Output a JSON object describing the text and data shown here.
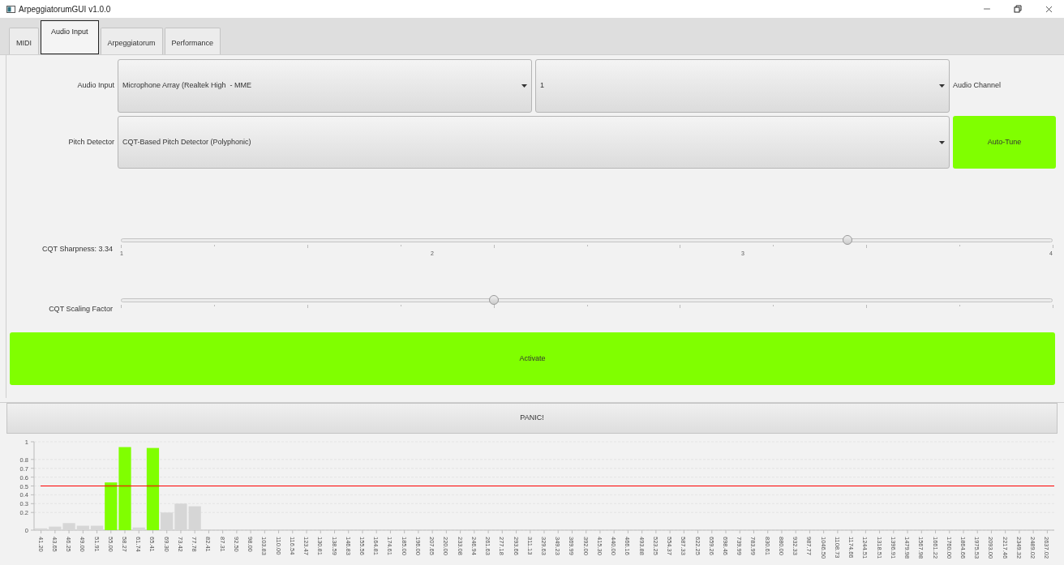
{
  "window": {
    "title": "ArpeggiatorumGUI v1.0.0"
  },
  "tabs": [
    {
      "label": "MIDI",
      "selected": false
    },
    {
      "label": "Audio Input",
      "selected": true
    },
    {
      "label": "Arpeggiatorum",
      "selected": false
    },
    {
      "label": "Performance",
      "selected": false
    }
  ],
  "audio_input": {
    "label": "Audio Input",
    "device": "Microphone Array (Realtek High  - MME",
    "channel": "1",
    "channel_label": "Audio Channel"
  },
  "pitch_detector": {
    "label": "Pitch Detector",
    "value": "CQT-Based Pitch Detector (Polyphonic)",
    "button": "Auto-Tune"
  },
  "sliders": [
    {
      "label": "CQT Sharpness: 3.34",
      "level": 0.78,
      "tick_labels": [
        "1",
        "2",
        "3",
        "4"
      ]
    },
    {
      "label": "CQT Scaling Factor",
      "level": 0.4
    }
  ],
  "activate_button": "Activate",
  "panic_button": "PANIC!",
  "chart_data": {
    "type": "bar",
    "categories": [
      "41.20",
      "43.65",
      "46.25",
      "49.00",
      "51.91",
      "55.00",
      "58.27",
      "61.74",
      "65.41",
      "69.30",
      "73.42",
      "77.78",
      "82.41",
      "87.31",
      "92.50",
      "98.00",
      "103.83",
      "110.00",
      "116.54",
      "123.47",
      "130.81",
      "138.59",
      "146.83",
      "155.56",
      "164.81",
      "174.61",
      "185.00",
      "196.00",
      "207.65",
      "220.00",
      "233.08",
      "246.94",
      "261.63",
      "277.18",
      "293.66",
      "311.13",
      "329.63",
      "349.23",
      "369.99",
      "392.00",
      "415.30",
      "440.00",
      "466.16",
      "493.88",
      "523.25",
      "554.37",
      "587.33",
      "622.25",
      "659.26",
      "698.46",
      "739.99",
      "783.99",
      "830.61",
      "880.00",
      "932.33",
      "987.77",
      "1046.50",
      "1108.73",
      "1174.66",
      "1244.51",
      "1318.51",
      "1396.91",
      "1479.98",
      "1567.98",
      "1661.22",
      "1760.00",
      "1864.66",
      "1975.53",
      "2093.00",
      "2217.46",
      "2349.32",
      "2489.02",
      "2637.02"
    ],
    "series": [
      {
        "color": "#d6d6d6",
        "values": [
          0.02,
          0.04,
          0.08,
          0.05,
          0.05,
          null,
          null,
          0.03,
          null,
          0.2,
          0.3,
          0.27,
          0,
          0,
          0,
          0,
          0,
          0,
          0,
          0,
          0,
          0,
          0,
          0,
          0,
          0,
          0,
          0,
          0,
          0,
          0,
          0,
          0,
          0,
          0,
          0,
          0,
          0,
          0,
          0,
          0,
          0,
          0,
          0,
          0,
          0,
          0,
          0,
          0,
          0,
          0,
          0,
          0,
          0,
          0,
          0,
          0,
          0,
          0,
          0,
          0,
          0,
          0,
          0,
          0,
          0,
          0,
          0,
          0,
          0,
          0,
          0,
          0
        ]
      },
      {
        "color": "#80ff00",
        "values": [
          null,
          null,
          null,
          null,
          null,
          0.54,
          0.94,
          null,
          0.93,
          null,
          null,
          null,
          null,
          null,
          null,
          null,
          null,
          null,
          null,
          null,
          null,
          null,
          null,
          null,
          null,
          null,
          null,
          null,
          null,
          null,
          null,
          null,
          null,
          null,
          null,
          null,
          null,
          null,
          null,
          null,
          null,
          null,
          null,
          null,
          null,
          null,
          null,
          null,
          null,
          null,
          null,
          null,
          null,
          null,
          null,
          null,
          null,
          null,
          null,
          null,
          null,
          null,
          null,
          null,
          null,
          null,
          null,
          null,
          null,
          null,
          null,
          null,
          null
        ]
      }
    ],
    "grid": true,
    "ylim": [
      0,
      1
    ],
    "yticks": [
      0,
      0.2,
      0.3,
      0.4,
      0.5,
      0.6,
      0.7,
      0.8,
      1
    ],
    "ref_lines": [
      {
        "axis": "y",
        "value": 0.5,
        "color": "#ff0000"
      }
    ]
  }
}
